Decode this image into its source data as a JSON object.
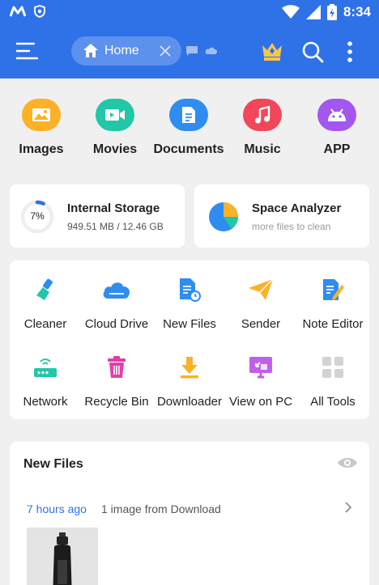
{
  "status_bar": {
    "left_icons": [
      "m-logo-icon",
      "shield-icon"
    ],
    "right_icons": [
      "wifi-icon",
      "signal-icon",
      "battery-icon"
    ],
    "time": "8:34"
  },
  "header": {
    "tab_label": "Home",
    "background": "#2f72e8"
  },
  "categories": [
    {
      "label": "Images",
      "icon": "images-icon",
      "color": "#fcb126"
    },
    {
      "label": "Movies",
      "icon": "movies-icon",
      "color": "#21c7a6"
    },
    {
      "label": "Documents",
      "icon": "documents-icon",
      "color": "#2f8df0"
    },
    {
      "label": "Music",
      "icon": "music-icon",
      "color": "#f2475b"
    },
    {
      "label": "APP",
      "icon": "app-icon",
      "color": "#a456f0"
    }
  ],
  "storage": {
    "title": "Internal Storage",
    "percent_label": "7%",
    "percent_used": 0.07,
    "usage": "949.51 MB / 12.46 GB"
  },
  "analyzer": {
    "title": "Space Analyzer",
    "subtitle": "more files to clean"
  },
  "tools": [
    {
      "label": "Cleaner",
      "icon": "cleaner-brush-icon"
    },
    {
      "label": "Cloud Drive",
      "icon": "cloud-drive-icon"
    },
    {
      "label": "New Files",
      "icon": "new-files-icon"
    },
    {
      "label": "Sender",
      "icon": "sender-icon"
    },
    {
      "label": "Note Editor",
      "icon": "note-editor-icon"
    },
    {
      "label": "Network",
      "icon": "network-router-icon"
    },
    {
      "label": "Recycle Bin",
      "icon": "recycle-bin-icon"
    },
    {
      "label": "Downloader",
      "icon": "downloader-icon"
    },
    {
      "label": "View on PC",
      "icon": "view-on-pc-icon"
    },
    {
      "label": "All Tools",
      "icon": "all-tools-grid-icon"
    }
  ],
  "new_files": {
    "heading": "New Files",
    "time_ago": "7 hours ago",
    "description": "1 image from Download"
  }
}
